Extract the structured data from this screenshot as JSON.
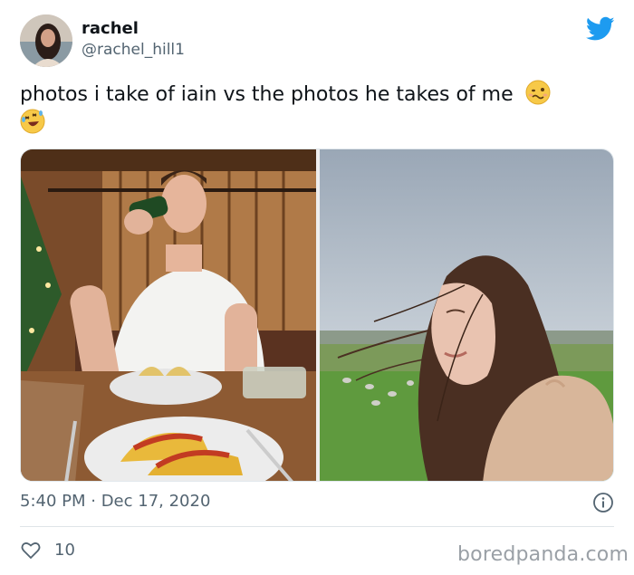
{
  "user": {
    "display_name": "rachel",
    "handle": "@rachel_hill1"
  },
  "tweet": {
    "text": "photos i take of iain vs the photos he takes of me",
    "emojis": [
      "woozy-face-emoji",
      "rolling-on-floor-laughing-emoji"
    ],
    "timestamp": "5:40 PM · Dec 17, 2020",
    "likes": "10"
  },
  "media": {
    "left_photo": "man drinking beer at table with tacos in wooden cabin",
    "right_photo": "woman with windblown hair in green field under cloudy sky"
  },
  "watermark": "boredpanda.com",
  "colors": {
    "twitter_blue": "#1d9bf0",
    "secondary_text": "#536471",
    "watermark_gray": "#9aa0a6"
  },
  "icons": [
    "twitter-bird-icon",
    "info-icon",
    "heart-icon"
  ]
}
